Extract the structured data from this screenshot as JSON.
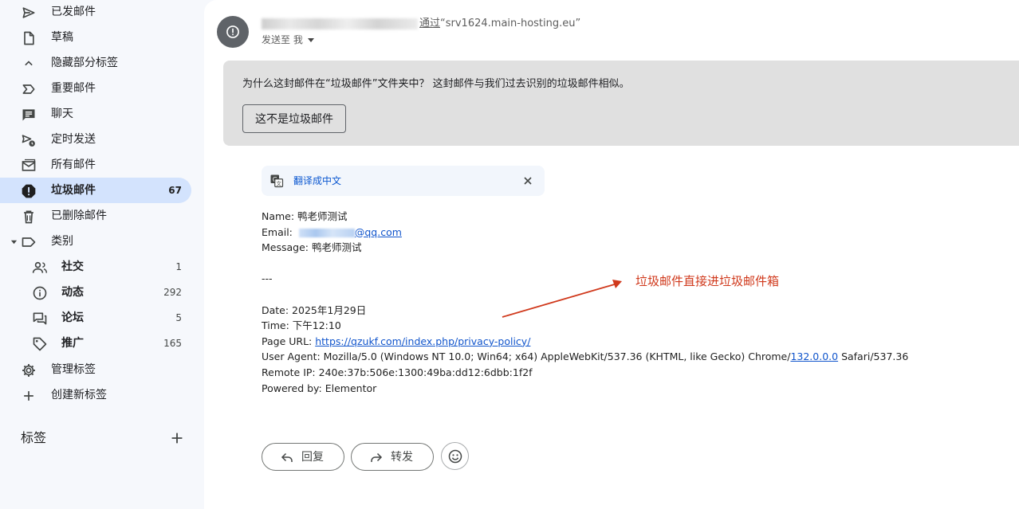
{
  "sidebar": {
    "items": [
      {
        "label": "已发邮件",
        "count": "",
        "icon": "send-icon"
      },
      {
        "label": "草稿",
        "count": "",
        "icon": "draft-icon"
      },
      {
        "label": "隐藏部分标签",
        "count": "",
        "icon": "chevron-up-icon"
      },
      {
        "label": "重要邮件",
        "count": "",
        "icon": "important-icon"
      },
      {
        "label": "聊天",
        "count": "",
        "icon": "chat-icon"
      },
      {
        "label": "定时发送",
        "count": "",
        "icon": "scheduled-send-icon"
      },
      {
        "label": "所有邮件",
        "count": "",
        "icon": "all-mail-icon"
      },
      {
        "label": "垃圾邮件",
        "count": "67",
        "icon": "spam-icon"
      },
      {
        "label": "已删除邮件",
        "count": "",
        "icon": "trash-icon"
      },
      {
        "label": "类别",
        "count": "",
        "icon": "label-icon"
      },
      {
        "label": "社交",
        "count": "1",
        "icon": "social-icon"
      },
      {
        "label": "动态",
        "count": "292",
        "icon": "updates-icon"
      },
      {
        "label": "论坛",
        "count": "5",
        "icon": "forums-icon"
      },
      {
        "label": "推广",
        "count": "165",
        "icon": "promotions-icon"
      },
      {
        "label": "管理标签",
        "count": "",
        "icon": "gear-icon"
      },
      {
        "label": "创建新标签",
        "count": "",
        "icon": "plus-icon"
      }
    ],
    "labels_heading": "标签"
  },
  "message": {
    "sender_via": "通过",
    "sender_host": "“srv1624.main-hosting.eu”",
    "to_line": "发送至 我",
    "spam_banner_text": "为什么这封邮件在“垃圾邮件”文件夹中？ 这封邮件与我们过去识别的垃圾邮件相似。",
    "not_spam_button": "这不是垃圾邮件",
    "translate_link": "翻译成中文",
    "body": {
      "name": "Name: 鸭老师测试",
      "email_prefix": "Email: ",
      "email_domain": "@qq.com",
      "message": "Message: 鸭老师测试",
      "separator": "---",
      "date": "Date: 2025年1月29日",
      "time": "Time: 下午12:10",
      "page_url_prefix": "Page URL: ",
      "page_url": "https://qzukf.com/index.php/privacy-policy/",
      "user_agent_prefix": "User Agent: Mozilla/5.0 (Windows NT 10.0; Win64; x64) AppleWebKit/537.36 (KHTML, like Gecko) Chrome/",
      "user_agent_link": "132.0.0.0",
      "user_agent_suffix": " Safari/537.36",
      "remote_ip": "Remote IP: 240e:37b:506e:1300:49ba:dd12:6dbb:1f2f",
      "powered_by": "Powered by: Elementor"
    },
    "annotation": "垃圾邮件直接进垃圾邮件箱",
    "reply_button": "回复",
    "forward_button": "转发"
  },
  "colors": {
    "active_nav": "#d3e3fd",
    "banner_bg": "#e0e0e0",
    "link": "#1155cc",
    "annotation": "#d0391c"
  }
}
